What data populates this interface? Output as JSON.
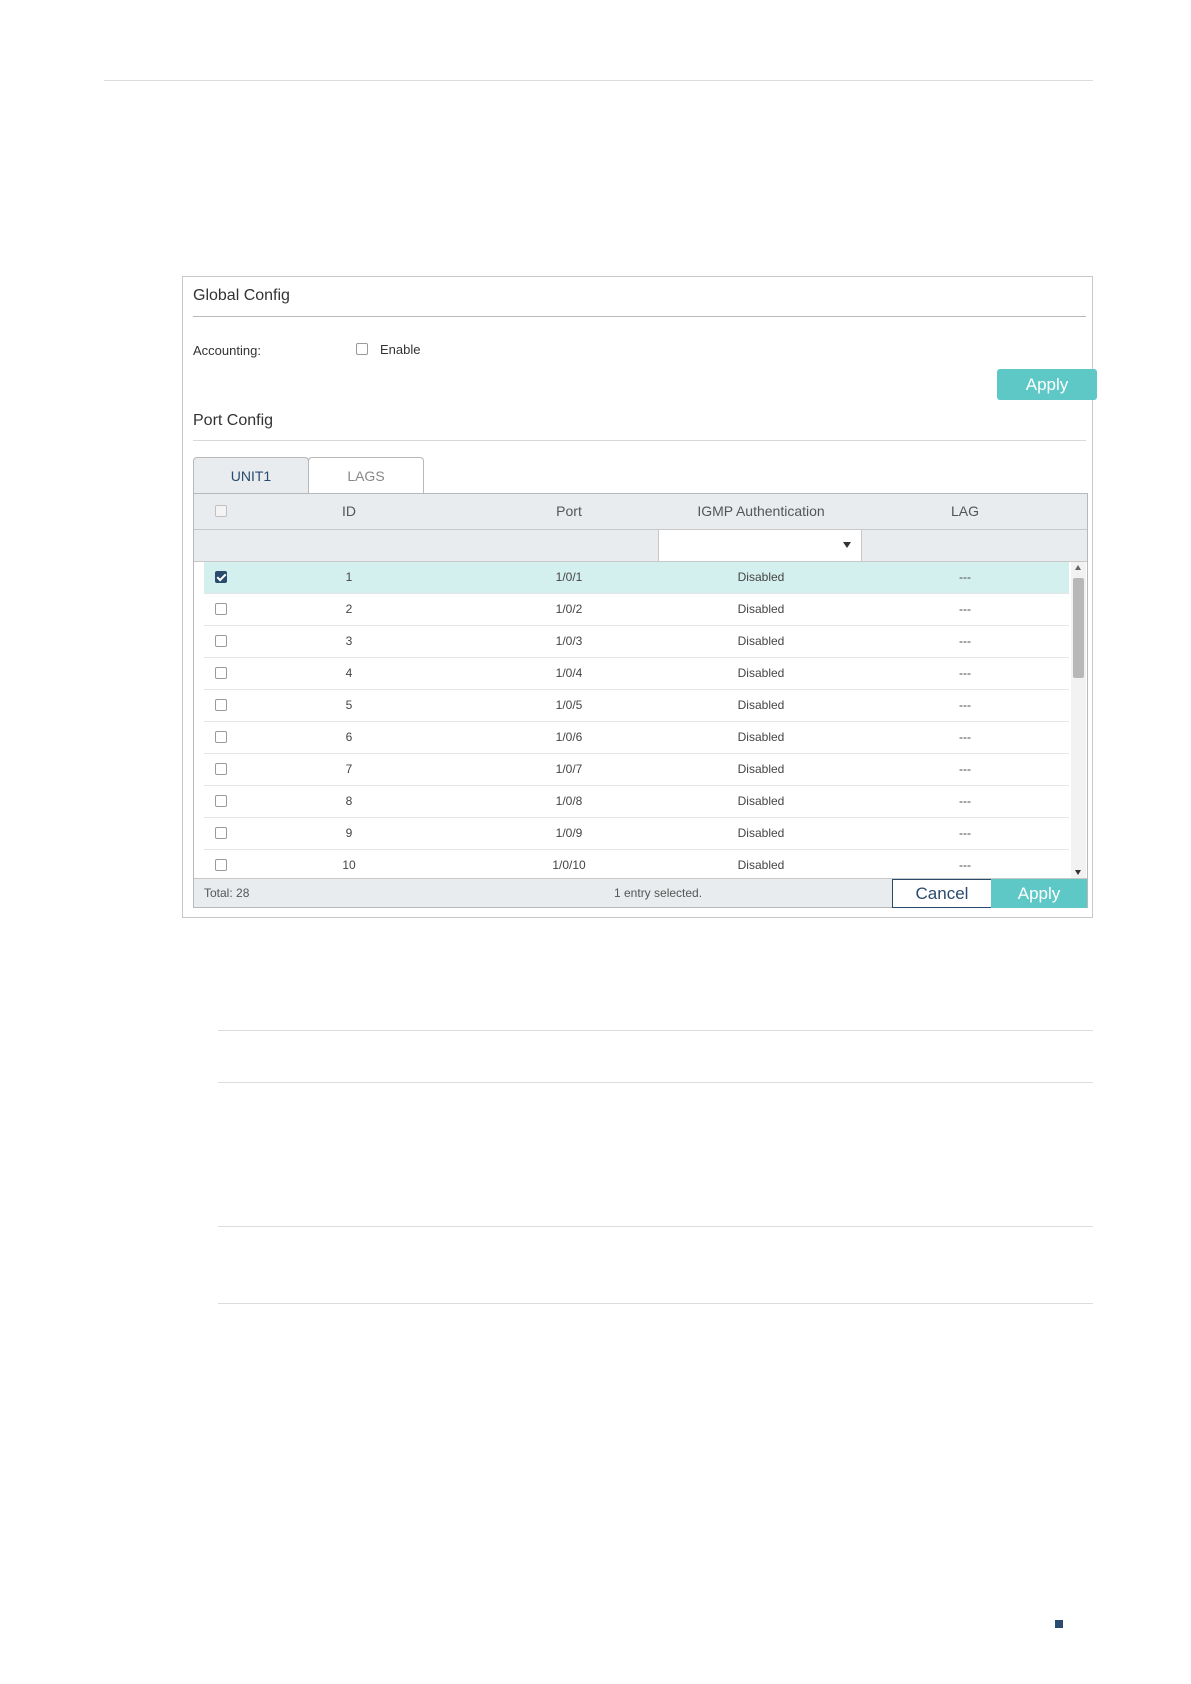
{
  "global_config": {
    "title": "Global Config",
    "accounting_label": "Accounting:",
    "enable_label": "Enable",
    "enable_checked": false,
    "apply_label": "Apply"
  },
  "port_config": {
    "title": "Port Config",
    "tabs": [
      {
        "label": "UNIT1",
        "active": true
      },
      {
        "label": "LAGS",
        "active": false
      }
    ],
    "columns": [
      "ID",
      "Port",
      "IGMP Authentication",
      "LAG"
    ],
    "rows": [
      {
        "id": "1",
        "port": "1/0/1",
        "auth": "Disabled",
        "lag": "---",
        "checked": true
      },
      {
        "id": "2",
        "port": "1/0/2",
        "auth": "Disabled",
        "lag": "---",
        "checked": false
      },
      {
        "id": "3",
        "port": "1/0/3",
        "auth": "Disabled",
        "lag": "---",
        "checked": false
      },
      {
        "id": "4",
        "port": "1/0/4",
        "auth": "Disabled",
        "lag": "---",
        "checked": false
      },
      {
        "id": "5",
        "port": "1/0/5",
        "auth": "Disabled",
        "lag": "---",
        "checked": false
      },
      {
        "id": "6",
        "port": "1/0/6",
        "auth": "Disabled",
        "lag": "---",
        "checked": false
      },
      {
        "id": "7",
        "port": "1/0/7",
        "auth": "Disabled",
        "lag": "---",
        "checked": false
      },
      {
        "id": "8",
        "port": "1/0/8",
        "auth": "Disabled",
        "lag": "---",
        "checked": false
      },
      {
        "id": "9",
        "port": "1/0/9",
        "auth": "Disabled",
        "lag": "---",
        "checked": false
      },
      {
        "id": "10",
        "port": "1/0/10",
        "auth": "Disabled",
        "lag": "---",
        "checked": false
      }
    ],
    "total_text": "Total: 28",
    "selected_text": "1 entry selected.",
    "cancel_label": "Cancel",
    "apply_label": "Apply"
  },
  "colors": {
    "accent": "#5ec8c6",
    "selected_row": "#d4f0ee",
    "header_bg": "#e8ecee",
    "checkbox_checked": "#2a4a6e"
  }
}
